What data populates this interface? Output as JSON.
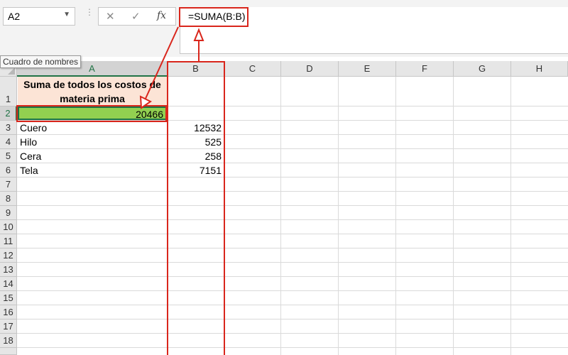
{
  "name_box": {
    "value": "A2",
    "tooltip": "Cuadro de nombres"
  },
  "formula_bar": {
    "cancel_icon": "✕",
    "enter_icon": "✓",
    "function_icon": "fx",
    "formula": "=SUMA(B:B)"
  },
  "columns": [
    "A",
    "B",
    "C",
    "D",
    "E",
    "F",
    "G",
    "H"
  ],
  "rows": [
    "1",
    "2",
    "3",
    "4",
    "5",
    "6",
    "7",
    "8",
    "9",
    "10",
    "11",
    "12",
    "13",
    "14",
    "15",
    "16",
    "17",
    "18"
  ],
  "cells": {
    "A1": "Suma de todos los costos de materia prima",
    "A2": "20466",
    "A3": "Cuero",
    "B3": "12532",
    "A4": "Hilo",
    "B4": "525",
    "A5": "Cera",
    "B5": "258",
    "A6": "Tela",
    "B6": "7151"
  },
  "colors": {
    "header_fill": "#fce4d6",
    "sum_fill": "#92d050",
    "annotation": "#d9261c",
    "active_green": "#217346"
  }
}
